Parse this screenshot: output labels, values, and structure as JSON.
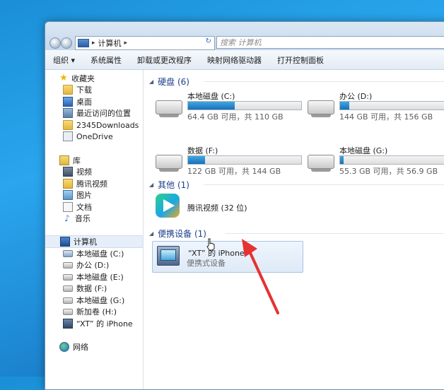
{
  "address": {
    "path_items": [
      "计算机"
    ],
    "search_placeholder": "搜索 计算机"
  },
  "toolbar": {
    "items": [
      "组织",
      "系统属性",
      "卸载或更改程序",
      "映射网络驱动器",
      "打开控制面板"
    ]
  },
  "sidebar": {
    "favorites": {
      "label": "收藏夹",
      "items": [
        "下载",
        "桌面",
        "最近访问的位置",
        "2345Downloads",
        "OneDrive"
      ]
    },
    "libraries": {
      "label": "库",
      "items": [
        "视频",
        "腾讯视频",
        "图片",
        "文档",
        "音乐"
      ]
    },
    "computer": {
      "label": "计算机",
      "items": [
        "本地磁盘 (C:)",
        "办公 (D:)",
        "本地磁盘 (E:)",
        "数据 (F:)",
        "本地磁盘 (G:)",
        "新加卷 (H:)",
        "“XT” 的 iPhone"
      ]
    },
    "network": {
      "label": "网络"
    }
  },
  "content": {
    "hard_disks": {
      "header": "硬盘 (6)",
      "drives": [
        {
          "name": "本地磁盘 (C:)",
          "info": "64.4 GB 可用，共 110 GB",
          "used_fraction": 0.41
        },
        {
          "name": "办公 (D:)",
          "info": "144 GB 可用，共 156 GB",
          "used_fraction": 0.08
        },
        {
          "name": "数据 (F:)",
          "info": "122 GB 可用，共 144 GB",
          "used_fraction": 0.15
        },
        {
          "name": "本地磁盘 (G:)",
          "info": "55.3 GB 可用，共 56.9 GB",
          "used_fraction": 0.03
        }
      ]
    },
    "other": {
      "header": "其他 (1)",
      "item": "腾讯视频 (32 位)"
    },
    "portable": {
      "header": "便携设备 (1)",
      "device_name": "“XT” 的 iPhone",
      "device_type": "便携式设备"
    }
  },
  "colors": {
    "group_header": "#1e3f8c",
    "drive_fill": "#1a6fb8",
    "arrow": "#e53232",
    "desktop_bg": "#2aa6ee"
  }
}
